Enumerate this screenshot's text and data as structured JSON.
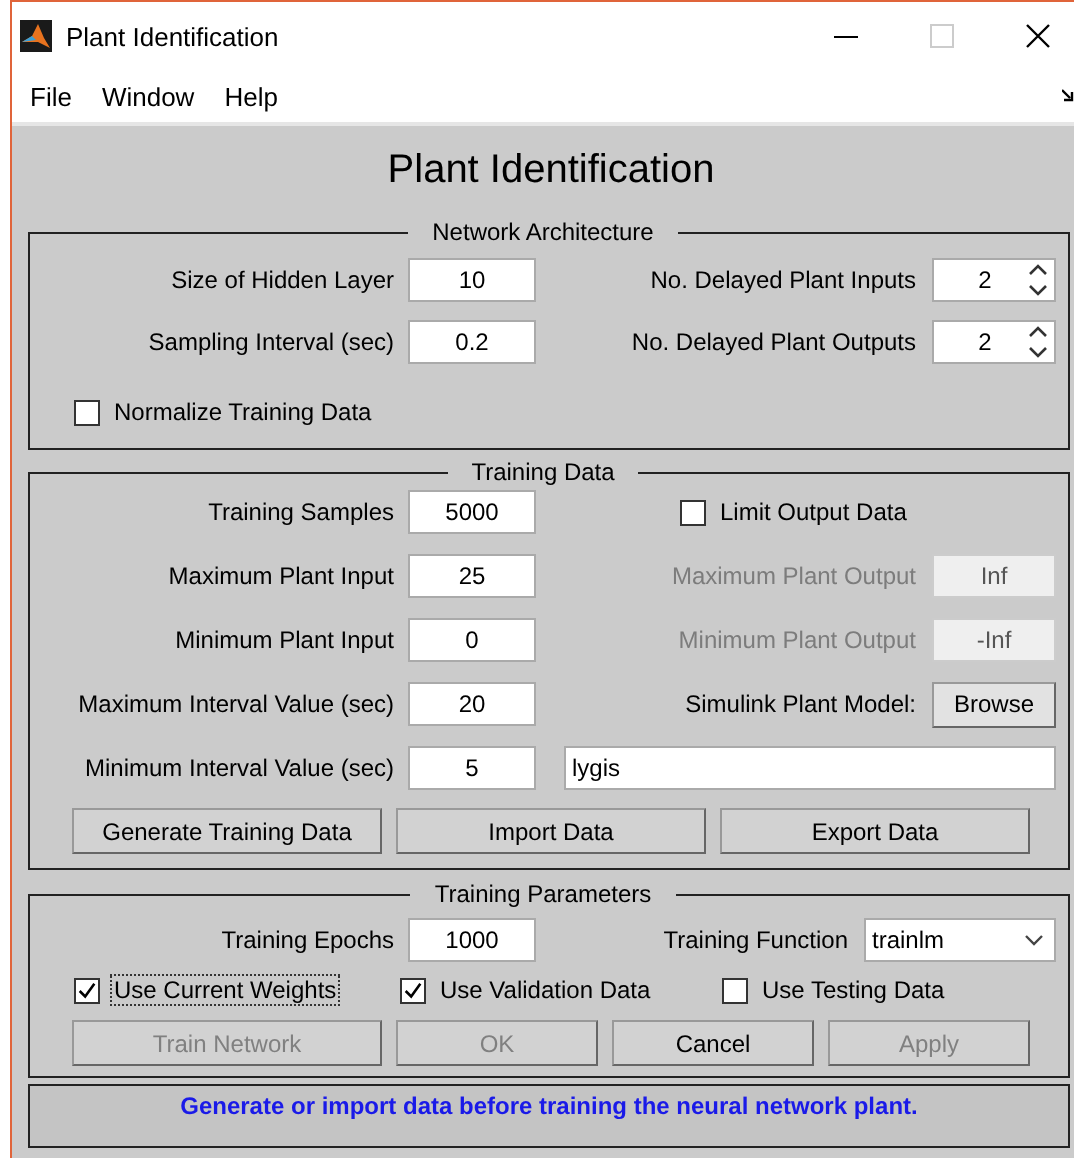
{
  "window": {
    "title": "Plant Identification"
  },
  "menu": [
    "File",
    "Window",
    "Help"
  ],
  "heading": "Plant Identification",
  "network_architecture": {
    "title": "Network Architecture",
    "fields": [
      {
        "label": "Size of Hidden Layer",
        "value": "10"
      },
      {
        "label": "Sampling Interval (sec)",
        "value": "0.2"
      }
    ],
    "spinners": [
      {
        "label": "No. Delayed Plant Inputs",
        "value": "2"
      },
      {
        "label": "No. Delayed Plant Outputs",
        "value": "2"
      }
    ],
    "normalize": {
      "label": "Normalize Training Data",
      "checked": false
    }
  },
  "training_data": {
    "title": "Training Data",
    "fields": [
      {
        "label": "Training Samples",
        "value": "5000"
      },
      {
        "label": "Maximum Plant Input",
        "value": "25"
      },
      {
        "label": "Minimum Plant Input",
        "value": "0"
      },
      {
        "label": "Maximum Interval Value (sec)",
        "value": "20"
      },
      {
        "label": "Minimum Interval Value (sec)",
        "value": "5"
      }
    ],
    "limit_output": {
      "label": "Limit Output Data",
      "checked": false
    },
    "output_fields": [
      {
        "label": "Maximum Plant Output",
        "value": "Inf",
        "disabled": true
      },
      {
        "label": "Minimum Plant Output",
        "value": "-Inf",
        "disabled": true
      }
    ],
    "simulink": {
      "label": "Simulink Plant Model:",
      "button": "Browse"
    },
    "model_name": "lygis",
    "buttons": [
      "Generate Training Data",
      "Import Data",
      "Export Data"
    ]
  },
  "training_parameters": {
    "title": "Training Parameters",
    "epochs": {
      "label": "Training Epochs",
      "value": "1000"
    },
    "function": {
      "label": "Training Function",
      "value": "trainlm"
    },
    "checkboxes": [
      {
        "label": "Use Current Weights",
        "checked": true,
        "focused": true
      },
      {
        "label": "Use Validation Data",
        "checked": true,
        "focused": false
      },
      {
        "label": "Use Testing Data",
        "checked": false,
        "focused": false
      }
    ],
    "buttons": [
      {
        "label": "Train Network",
        "disabled": true
      },
      {
        "label": "OK",
        "disabled": true
      },
      {
        "label": "Cancel",
        "disabled": false
      },
      {
        "label": "Apply",
        "disabled": true
      }
    ]
  },
  "status": "Generate or import data before training the neural network plant."
}
